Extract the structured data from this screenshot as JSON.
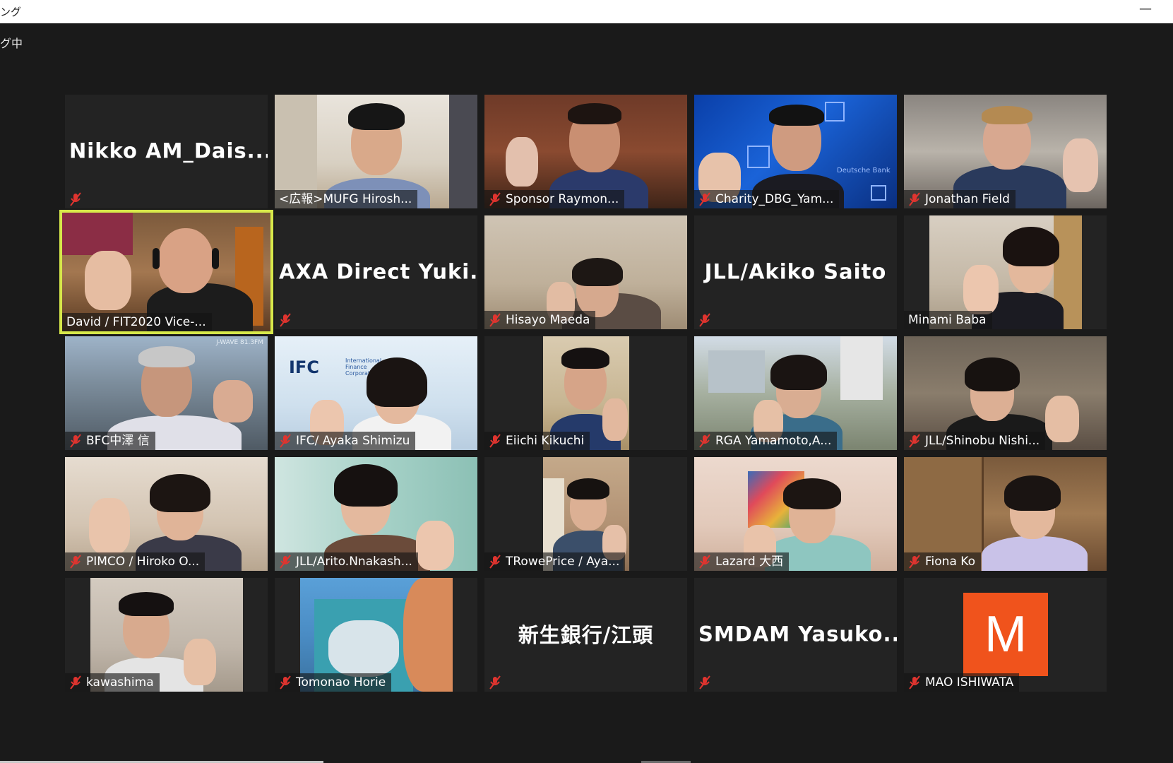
{
  "window": {
    "title": "ング",
    "minimize_symbol": "—"
  },
  "subbar": {
    "status_text": "グ中"
  },
  "accent": {
    "active_speaker": "#d7e84a",
    "mute_icon": "#e0342f"
  },
  "participants": [
    {
      "name": "Nikko AM_Dais...",
      "display": "name",
      "muted": true
    },
    {
      "name": "<広報>MUFG Hirosh...",
      "display": "video",
      "muted": false
    },
    {
      "name": "Sponsor Raymon...",
      "display": "video",
      "muted": true
    },
    {
      "name": "Charity_DBG_Yam...",
      "display": "video",
      "muted": true
    },
    {
      "name": "Jonathan Field",
      "display": "video",
      "muted": true
    },
    {
      "name": "David / FIT2020 Vice-...",
      "display": "video",
      "muted": false,
      "active": true
    },
    {
      "name": "AXA Direct Yuki...",
      "display": "name",
      "muted": true
    },
    {
      "name": "Hisayo Maeda",
      "display": "video",
      "muted": true
    },
    {
      "name": "JLL/Akiko Saito",
      "display": "name",
      "muted": true
    },
    {
      "name": "Minami Baba",
      "display": "video",
      "muted": false
    },
    {
      "name": "BFC中澤 信",
      "display": "video",
      "muted": true
    },
    {
      "name": "IFC/ Ayaka Shimizu",
      "display": "video",
      "muted": true
    },
    {
      "name": "Eiichi Kikuchi",
      "display": "video",
      "muted": true
    },
    {
      "name": "RGA Yamamoto,A...",
      "display": "video",
      "muted": true
    },
    {
      "name": "JLL/Shinobu Nishi...",
      "display": "video",
      "muted": true
    },
    {
      "name": "PIMCO / Hiroko O...",
      "display": "video",
      "muted": true
    },
    {
      "name": "JLL/Arito.Nnakash...",
      "display": "video",
      "muted": true
    },
    {
      "name": "TRowePrice / Aya...",
      "display": "video",
      "muted": true
    },
    {
      "name": "Lazard 大西",
      "display": "video",
      "muted": true
    },
    {
      "name": "Fiona Ko",
      "display": "video",
      "muted": true
    },
    {
      "name": "kawashima",
      "display": "video",
      "muted": true
    },
    {
      "name": "Tomonao Horie",
      "display": "video",
      "muted": true
    },
    {
      "name": "新生銀行/江頭",
      "display": "name",
      "muted": true
    },
    {
      "name": "SMDAM Yasuko...",
      "display": "name",
      "muted": true
    },
    {
      "name": "MAO ISHIWATA",
      "display": "avatar",
      "muted": true,
      "avatar_letter": "M",
      "avatar_color": "#f0531c"
    }
  ],
  "tile_texts": {
    "ifc_logo": "IFC",
    "ifc_sub": "International Finance Corporation",
    "db_watermark": "Deutsche Bank",
    "wave_watermark": "J-WAVE 81.3FM"
  }
}
